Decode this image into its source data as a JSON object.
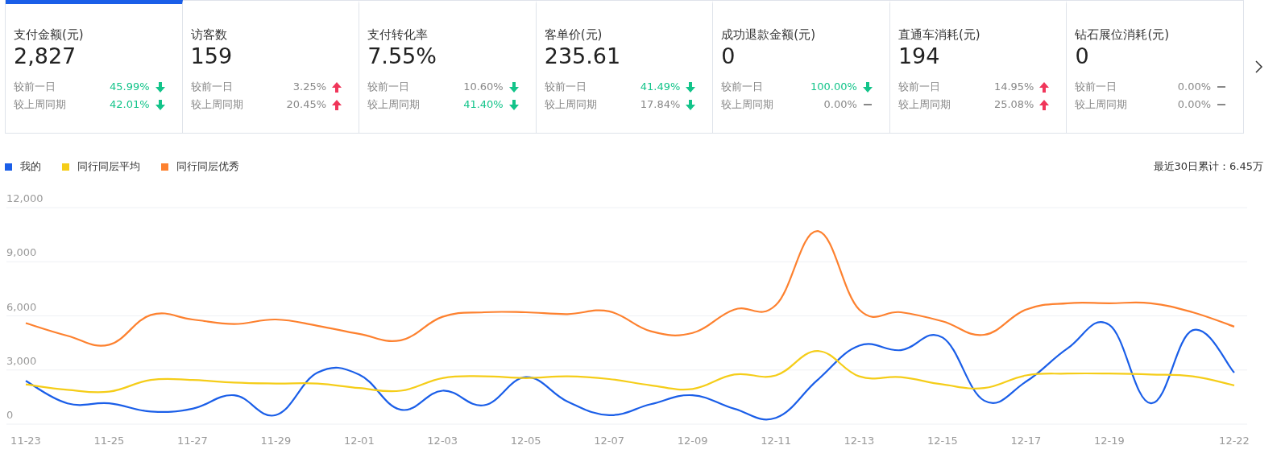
{
  "cards": [
    {
      "title": "支付金额(元)",
      "value": "2,827",
      "selected": true,
      "comparisons": [
        {
          "label": "较前一日",
          "percent": "45.99%",
          "kind": "down",
          "highlight": true
        },
        {
          "label": "较上周同期",
          "percent": "42.01%",
          "kind": "down",
          "highlight": true
        }
      ]
    },
    {
      "title": "访客数",
      "value": "159",
      "selected": false,
      "comparisons": [
        {
          "label": "较前一日",
          "percent": "3.25%",
          "kind": "up",
          "highlight": false
        },
        {
          "label": "较上周同期",
          "percent": "20.45%",
          "kind": "up",
          "highlight": false
        }
      ]
    },
    {
      "title": "支付转化率",
      "value": "7.55%",
      "selected": false,
      "comparisons": [
        {
          "label": "较前一日",
          "percent": "10.60%",
          "kind": "down",
          "highlight": false
        },
        {
          "label": "较上周同期",
          "percent": "41.40%",
          "kind": "down",
          "highlight": true
        }
      ]
    },
    {
      "title": "客单价(元)",
      "value": "235.61",
      "selected": false,
      "comparisons": [
        {
          "label": "较前一日",
          "percent": "41.49%",
          "kind": "down",
          "highlight": true
        },
        {
          "label": "较上周同期",
          "percent": "17.84%",
          "kind": "down",
          "highlight": false
        }
      ]
    },
    {
      "title": "成功退款金额(元)",
      "value": "0",
      "selected": false,
      "comparisons": [
        {
          "label": "较前一日",
          "percent": "100.00%",
          "kind": "down",
          "highlight": true
        },
        {
          "label": "较上周同期",
          "percent": "0.00%",
          "kind": "flat",
          "highlight": false
        }
      ]
    },
    {
      "title": "直通车消耗(元)",
      "value": "194",
      "selected": false,
      "comparisons": [
        {
          "label": "较前一日",
          "percent": "14.95%",
          "kind": "up",
          "highlight": false
        },
        {
          "label": "较上周同期",
          "percent": "25.08%",
          "kind": "up",
          "highlight": false
        }
      ]
    },
    {
      "title": "钻石展位消耗(元)",
      "value": "0",
      "selected": false,
      "comparisons": [
        {
          "label": "较前一日",
          "percent": "0.00%",
          "kind": "flat",
          "highlight": false
        },
        {
          "label": "较上周同期",
          "percent": "0.00%",
          "kind": "flat",
          "highlight": false
        }
      ]
    }
  ],
  "total": "最近30日累计：6.45万",
  "chart_data": {
    "type": "line",
    "categories": [
      "11-23",
      null,
      "11-25",
      null,
      "11-27",
      null,
      "11-29",
      null,
      "12-01",
      null,
      "12-03",
      null,
      "12-05",
      null,
      "12-07",
      null,
      "12-09",
      null,
      "12-11",
      null,
      "12-13",
      null,
      "12-15",
      null,
      "12-17",
      null,
      "12-19",
      null,
      null,
      "12-22"
    ],
    "grid": true,
    "ylim": [
      0,
      12000
    ],
    "yticks": [
      {
        "value": 0,
        "label": "0"
      },
      {
        "value": 3000,
        "label": "3,000"
      },
      {
        "value": 6000,
        "label": "6,000"
      },
      {
        "value": 9000,
        "label": "9,000"
      },
      {
        "value": 12000,
        "label": "12,000"
      }
    ],
    "series": [
      {
        "name": "我的",
        "color": "#1a5ee8",
        "values": [
          2400,
          1150,
          1150,
          700,
          850,
          1600,
          500,
          2850,
          2750,
          800,
          1850,
          1050,
          2600,
          1250,
          500,
          1100,
          1600,
          850,
          350,
          2450,
          4350,
          4100,
          4800,
          1300,
          2350,
          4200,
          5500,
          1150,
          5200,
          2850
        ]
      },
      {
        "name": "同行同层平均",
        "color": "#f5cd19",
        "values": [
          2200,
          1900,
          1800,
          2450,
          2450,
          2300,
          2250,
          2250,
          2000,
          1850,
          2550,
          2650,
          2550,
          2650,
          2500,
          2150,
          1950,
          2750,
          2700,
          4050,
          2650,
          2600,
          2200,
          2000,
          2700,
          2800,
          2800,
          2750,
          2650,
          2150
        ]
      },
      {
        "name": "同行同层优秀",
        "color": "#fd812f",
        "values": [
          5600,
          4900,
          4400,
          6050,
          5800,
          5550,
          5800,
          5450,
          5000,
          4650,
          5950,
          6200,
          6200,
          6100,
          6250,
          5150,
          5050,
          6350,
          6600,
          10700,
          6350,
          6200,
          5700,
          4950,
          6350,
          6700,
          6700,
          6700,
          6200,
          5400
        ]
      }
    ]
  }
}
